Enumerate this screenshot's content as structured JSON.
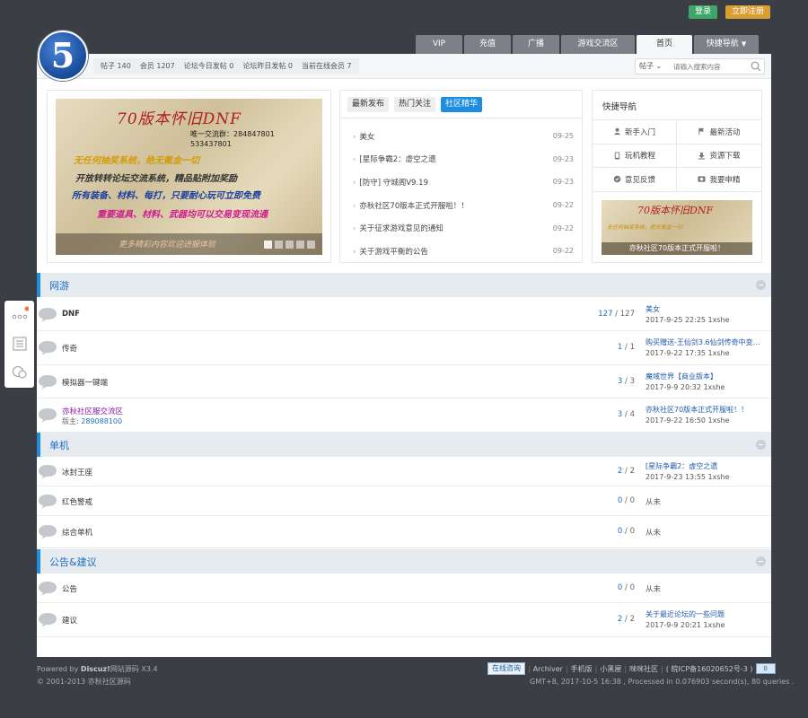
{
  "top_buttons": {
    "login": "登录",
    "register": "立即注册"
  },
  "logo": {
    "text": "5"
  },
  "nav": {
    "tabs": [
      {
        "label": "VIP",
        "width": 52
      },
      {
        "label": "充值",
        "width": 52
      },
      {
        "label": "广播",
        "width": 52
      },
      {
        "label": "游戏交流区",
        "width": 82
      },
      {
        "label": "首页",
        "width": 62,
        "active": true
      },
      {
        "label": "快捷导航",
        "width": 72,
        "caret": true
      }
    ]
  },
  "stats": {
    "posts": "帖子 140",
    "members": "会员 1207",
    "today": "论坛今日发帖 0",
    "yesterday": "论坛昨日发帖 0",
    "online": "当前在线会员 7"
  },
  "search": {
    "type": "帖子",
    "placeholder": "请输入搜索内容"
  },
  "banner": {
    "title": "70版本怀旧DNF",
    "qq_line1": "唯一交流群：284847801",
    "qq_line2": "533437801",
    "line1": "无任何抽奖系统，绝无氪金一切",
    "line2": "开放转转论坛交流系统，精品贴附加奖励",
    "line3": "所有装备、材料、每打，只要耐心玩可立即免费",
    "line4": "重要道具、材料、武器均可以交易变现流通",
    "caption": "更多精彩内容欢迎进服体验"
  },
  "news": {
    "tabs": [
      "最新发布",
      "热门关注",
      "社区精华"
    ],
    "active_tab": 2,
    "items": [
      {
        "title": "美女",
        "date": "09-25"
      },
      {
        "title": "[星际争霸2：虚空之遗",
        "date": "09-23"
      },
      {
        "title": "[防守] 守城阁V9.19",
        "date": "09-23"
      },
      {
        "title": "亦秋社区70版本正式开服啦！！",
        "date": "09-22"
      },
      {
        "title": "关于征求游戏意见的通知",
        "date": "09-22"
      },
      {
        "title": "关于游戏平衡的公告",
        "date": "09-22"
      }
    ]
  },
  "quick": {
    "title": "快捷导航",
    "items": [
      {
        "label": "新手入门",
        "icon": "user-icon"
      },
      {
        "label": "最新活动",
        "icon": "flag-icon"
      },
      {
        "label": "玩机教程",
        "icon": "phone-icon"
      },
      {
        "label": "资源下载",
        "icon": "download-icon"
      },
      {
        "label": "意见反馈",
        "icon": "feedback-icon"
      },
      {
        "label": "我要申精",
        "icon": "camera-icon"
      }
    ],
    "thumb_title": "70版本怀旧DNF",
    "thumb_sub": "无任何抽奖系统，绝无氪金一切",
    "thumb_caption": "亦秋社区70版本正式开服啦！"
  },
  "sections": [
    {
      "title": "网游",
      "forums": [
        {
          "name": "DNF",
          "bold": true,
          "count_a": "127",
          "count_b": "127",
          "last_title": "美女",
          "last_meta": "2017-9-25 22:25 1xshe"
        },
        {
          "name": "传奇",
          "count_a": "1",
          "count_b": "1",
          "last_title": "购买赠送-王仙剑3.6仙剑传奇中变…",
          "last_meta": "2017-9-22 17:35 1xshe"
        },
        {
          "name": "模拟器一键端",
          "count_a": "3",
          "count_b": "3",
          "last_title": "魔域世界【商业版本】",
          "last_meta": "2017-9-9 20:32 1xshe"
        },
        {
          "name": "亦秋社区服交流区",
          "purple": true,
          "moderator_label": "版主:",
          "moderator": "289088100",
          "count_a": "3",
          "count_b": "4",
          "last_title": "亦秋社区70版本正式开服啦！！",
          "last_meta": "2017-9-22 16:50 1xshe"
        }
      ]
    },
    {
      "title": "单机",
      "forums": [
        {
          "name": "冰封王座",
          "count_a": "2",
          "count_b": "2",
          "last_title": "[星际争霸2：虚空之遗",
          "last_meta": "2017-9-23 13:55 1xshe"
        },
        {
          "name": "红色警戒",
          "count_a": "0",
          "count_b": "0",
          "never": "从未"
        },
        {
          "name": "综合单机",
          "count_a": "0",
          "count_b": "0",
          "never": "从未"
        }
      ]
    },
    {
      "title": "公告&建议",
      "forums": [
        {
          "name": "公告",
          "count_a": "0",
          "count_b": "0",
          "never": "从未"
        },
        {
          "name": "建议",
          "count_a": "2",
          "count_b": "2",
          "last_title": "关于最近论坛的一些问题",
          "last_meta": "2017-9-9 20:21 1xshe"
        }
      ]
    }
  ],
  "footer": {
    "powered_prefix": "Powered by",
    "powered_name": "Discuz!",
    "powered_suffix": "网站源码 X3.4",
    "copyright": "© 2001-2013 亦秋社区源码",
    "chat": "在线咨询",
    "links": [
      "Archiver",
      "手机版",
      "小黑屋",
      "咪咪社区",
      "( 皖ICP备16020652号-3 )"
    ],
    "badge": "0",
    "gmt": "GMT+8, 2017-10-5 16:38 , Processed in 0.076903 second(s), 80 queries ."
  },
  "colors": {
    "accent": "#1e8de0",
    "login": "#3fa66a",
    "register": "#d99e33",
    "background": "#3b3f45"
  }
}
